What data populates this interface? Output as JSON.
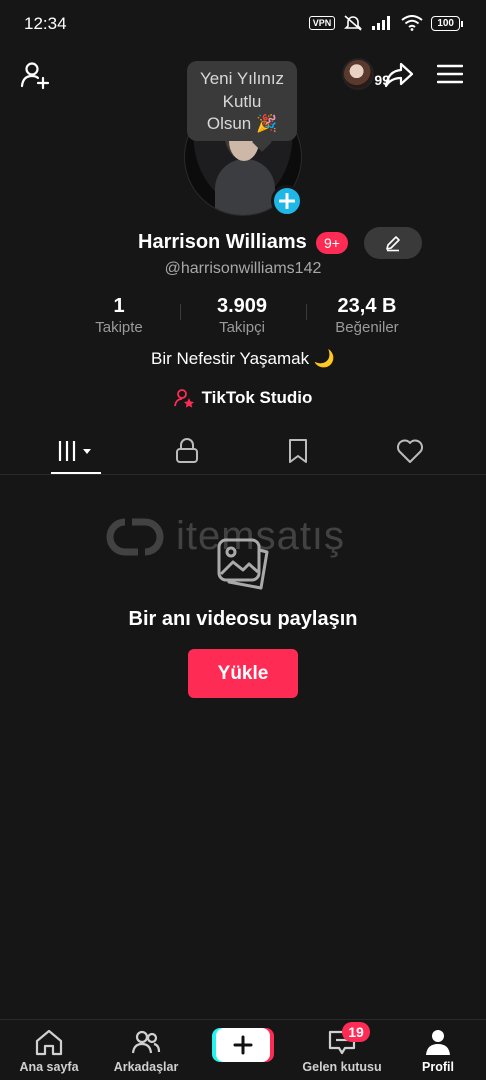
{
  "status_bar": {
    "time": "12:34",
    "vpn": "VPN",
    "battery": "100"
  },
  "top_bar": {
    "story_count": "99"
  },
  "profile": {
    "bubble_line1": "Yeni Yılınız",
    "bubble_line2": "Kutlu",
    "bubble_line3": "Olsun 🎉",
    "name": "Harrison Williams",
    "notif_badge": "9+",
    "handle": "@harrisonwilliams142",
    "bio": "Bir Nefestir Yaşamak 🌙",
    "studio_label": "TikTok Studio"
  },
  "stats": [
    {
      "value": "1",
      "label": "Takipte"
    },
    {
      "value": "3.909",
      "label": "Takipçi"
    },
    {
      "value": "23,4 B",
      "label": "Beğeniler"
    }
  ],
  "empty_state": {
    "message": "Bir anı videosu paylaşın",
    "upload_label": "Yükle"
  },
  "watermark": {
    "text": "itemsatış"
  },
  "bottom_nav": {
    "home": "Ana sayfa",
    "friends": "Arkadaşlar",
    "inbox": "Gelen kutusu",
    "inbox_badge": "19",
    "profile": "Profil"
  },
  "colors": {
    "accent": "#fe2c55",
    "cyan": "#25f4ee",
    "plus_badge": "#1fb7e6",
    "background": "#161616"
  }
}
